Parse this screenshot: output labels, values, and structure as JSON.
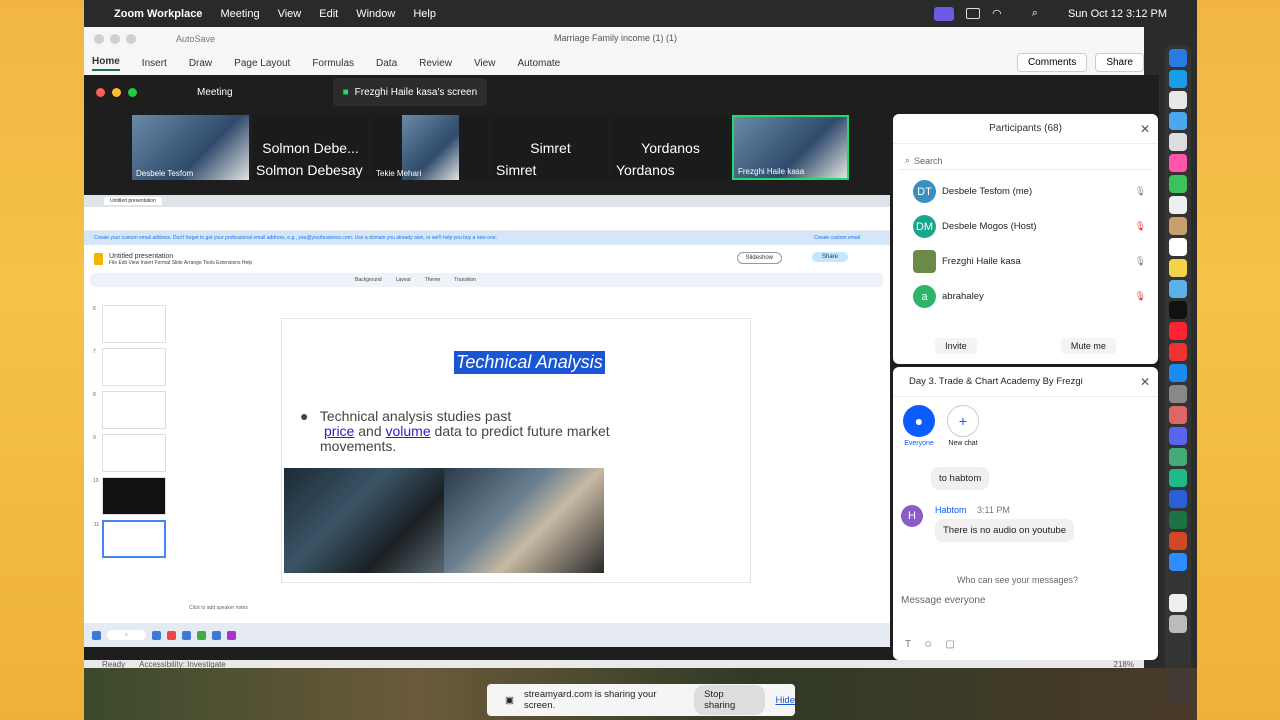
{
  "menubar": {
    "app": "Zoom Workplace",
    "items": [
      "Meeting",
      "View",
      "Edit",
      "Window",
      "Help"
    ],
    "clock": "Sun Oct 12  3:12 PM"
  },
  "excel": {
    "autosave": "AutoSave",
    "doc_title": "Marriage Family income (1) (1)",
    "tabs": [
      "Home",
      "Insert",
      "Draw",
      "Page Layout",
      "Formulas",
      "Data",
      "Review",
      "View",
      "Automate"
    ],
    "comments": "Comments",
    "share": "Share",
    "status_ready": "Ready",
    "status_access": "Accessibility: Investigate",
    "zoom": "218%"
  },
  "zoom": {
    "meeting_label": "Meeting",
    "tab_label": "Frezghi Haile kasa's screen",
    "gallery": [
      {
        "name": "Desbele Tesfom",
        "big": ""
      },
      {
        "name": "Solmon Debesay",
        "big": "Solmon Debe..."
      },
      {
        "name": "Tekie Mehari",
        "big": ""
      },
      {
        "name": "Simret",
        "big": "Simret"
      },
      {
        "name": "Yordanos",
        "big": "Yordanos"
      },
      {
        "name": "Frezghi Haile kasa",
        "big": ""
      }
    ]
  },
  "slides": {
    "doc_title": "Untitled presentation",
    "menu": "File  Edit  View  Insert  Format  Slide  Arrange  Tools  Extensions  Help",
    "slideshow": "Slideshow",
    "share": "Share",
    "toolbar": [
      "Background",
      "Layout",
      "Theme",
      "Transition"
    ],
    "banner": "Create your custom email address. Don't forget to get your professional email address, e.g., you@yourbusiness.com. Use a domain you already own, or we'll help you buy a new one.",
    "banner_action": "Create custom email",
    "title": "Technical Analysis",
    "bullet_pre": "Technical analysis  studies past",
    "word_price": "price",
    "word_and": " and ",
    "word_volume": "volume",
    "bullet_post": " data to predict future market",
    "bullet_end": "movements.",
    "notes": "Click to add speaker notes",
    "thumb_nums": [
      "6",
      "7",
      "8",
      "9",
      "10",
      "11"
    ]
  },
  "participants": {
    "title": "Participants (68)",
    "search": "Search",
    "list": [
      {
        "initials": "DT",
        "name": "Desbele Tesfom (me)",
        "color": "#3a8fbf"
      },
      {
        "initials": "DM",
        "name": "Desbele Mogos (Host)",
        "color": "#17a78a"
      },
      {
        "initials": "",
        "name": "Frezghi Haile kasa",
        "color": "#6b8a4a"
      },
      {
        "initials": "a",
        "name": "abrahaley",
        "color": "#2cb56a"
      }
    ],
    "invite": "Invite",
    "mute": "Mute me"
  },
  "chat": {
    "title": "Day 3. Trade & Chart Academy By Frezgi",
    "everyone": "Everyone",
    "new_chat": "New chat",
    "msg1": "to habtom",
    "sender": "Habtom",
    "time": "3:11 PM",
    "msg2": "There is no audio on youtube",
    "who_can_see": "Who can see your messages?",
    "placeholder": "Message everyone"
  },
  "streamyard": {
    "text": "streamyard.com is sharing your screen.",
    "stop": "Stop sharing",
    "hide": "Hide"
  }
}
